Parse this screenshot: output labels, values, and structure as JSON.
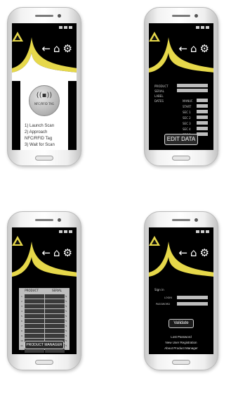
{
  "header": {
    "nav_back": "←",
    "nav_home": "⌂",
    "nav_settings": "⚙"
  },
  "phone1": {
    "badge_text": "NFC/RFID TAG",
    "steps": [
      "1) Launch Scan",
      "2) Approach NFC/RFID Tag",
      "3) Wait for Scan"
    ]
  },
  "phone2": {
    "fields": [
      "PRODUCT",
      "SERIAL",
      "LABEL",
      "DATES"
    ],
    "right_labels": [
      "MANUF.",
      "START",
      "SEC 1",
      "SEC 2",
      "SEC 3",
      "SEC 4",
      "SEC 5"
    ],
    "edit_label": "EDIT DATA"
  },
  "phone3": {
    "col_product": "PRODUCT",
    "col_serial": "SERIAL",
    "rows": [
      "1",
      "2",
      "3",
      "4",
      "5",
      "6",
      "7",
      "8",
      "9",
      "10",
      "11",
      "12"
    ],
    "button_label": "PRODUCT MANAGER"
  },
  "phone4": {
    "title": "Sign in",
    "login_label": "LOGIN",
    "password_label": "PASSWORD",
    "validate_label": "Validate",
    "links": [
      "Lost Password",
      "New User Registration",
      "About Product Manager"
    ]
  },
  "colors": {
    "accent": "#e6d84a",
    "screen_bg": "#000000",
    "field_bg": "#bdbdbd"
  }
}
